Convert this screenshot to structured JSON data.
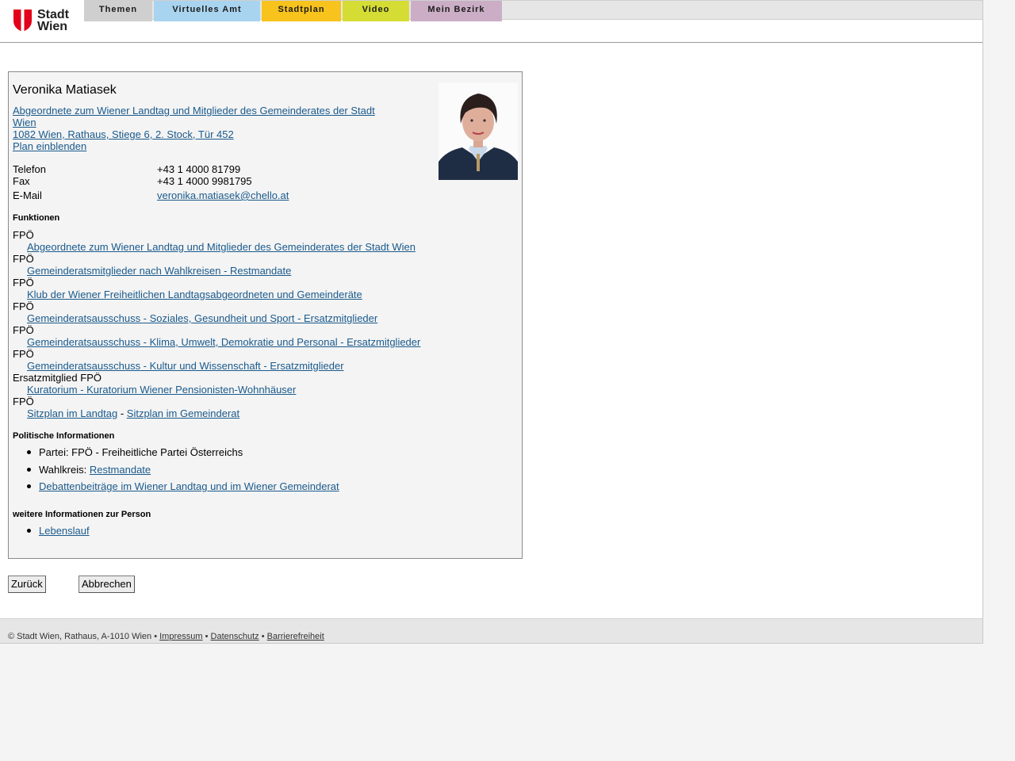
{
  "brand": {
    "line1": "Stadt",
    "line2": "Wien",
    "red": "#e2001a"
  },
  "nav": [
    {
      "label": "Themen",
      "color": "#cfcfcf"
    },
    {
      "label": "Virtuelles Amt",
      "color": "#a9d4ef"
    },
    {
      "label": "Stadtplan",
      "color": "#f7c31c"
    },
    {
      "label": "Video",
      "color": "#d5dd35"
    },
    {
      "label": "Mein Bezirk",
      "color": "#cbaec6"
    }
  ],
  "person": {
    "name": "Veronika Matiasek",
    "role_line1": "Abgeordnete zum Wiener Landtag und Mitglieder des Gemeinderates der Stadt",
    "role_line2": "Wien",
    "address": "1082 Wien, Rathaus, Stiege 6, 2. Stock, Tür 452",
    "plan_link": "Plan einblenden",
    "photo_icon": "portrait-photo"
  },
  "contact": {
    "phone_label": "Telefon",
    "phone": "+43 1 4000 81799",
    "fax_label": "Fax",
    "fax": "+43 1 4000 9981795",
    "email_label": "E-Mail",
    "email": "veronika.matiasek@chello.at"
  },
  "functions": {
    "heading": "Funktionen",
    "items": [
      {
        "party": "FPÖ",
        "link": "Abgeordnete zum Wiener Landtag und Mitglieder des Gemeinderates der Stadt Wien"
      },
      {
        "party": "FPÖ",
        "link": "Gemeinderatsmitglieder nach Wahlkreisen - Restmandate"
      },
      {
        "party": "FPÖ",
        "link": "Klub der Wiener Freiheitlichen Landtagsabgeordneten und Gemeinderäte"
      },
      {
        "party": "FPÖ",
        "link": "Gemeinderatsausschuss - Soziales, Gesundheit und Sport - Ersatzmitglieder"
      },
      {
        "party": "FPÖ",
        "link": "Gemeinderatsausschuss - Klima, Umwelt, Demokratie und Personal - Ersatzmitglieder"
      },
      {
        "party": "FPÖ",
        "link": "Gemeinderatsausschuss - Kultur und Wissenschaft - Ersatzmitglieder"
      },
      {
        "party": "Ersatzmitglied FPÖ",
        "link": "Kuratorium - Kuratorium Wiener Pensionisten-Wohnhäuser"
      }
    ],
    "last_party": "FPÖ",
    "seat_landtag": "Sitzplan im Landtag",
    "seat_sep": "-",
    "seat_gemeinderat": "Sitzplan im Gemeinderat"
  },
  "political": {
    "heading": "Politische Informationen",
    "party_text": "Partei: FPÖ - Freiheitliche Partei Österreichs",
    "wahlkreis_label": "Wahlkreis:",
    "wahlkreis_link": "Restmandate",
    "debates_link": "Debattenbeiträge im Wiener Landtag und im Wiener Gemeinderat"
  },
  "more": {
    "heading": "weitere Informationen zur Person",
    "cv_link": "Lebenslauf"
  },
  "buttons": {
    "back": "Zurück",
    "cancel": "Abbrechen"
  },
  "footer": {
    "copyright": "© Stadt Wien, Rathaus, A-1010 Wien",
    "sep": "•",
    "impressum": "Impressum",
    "datenschutz": "Datenschutz",
    "barrierefreiheit": "Barrierefreiheit"
  }
}
